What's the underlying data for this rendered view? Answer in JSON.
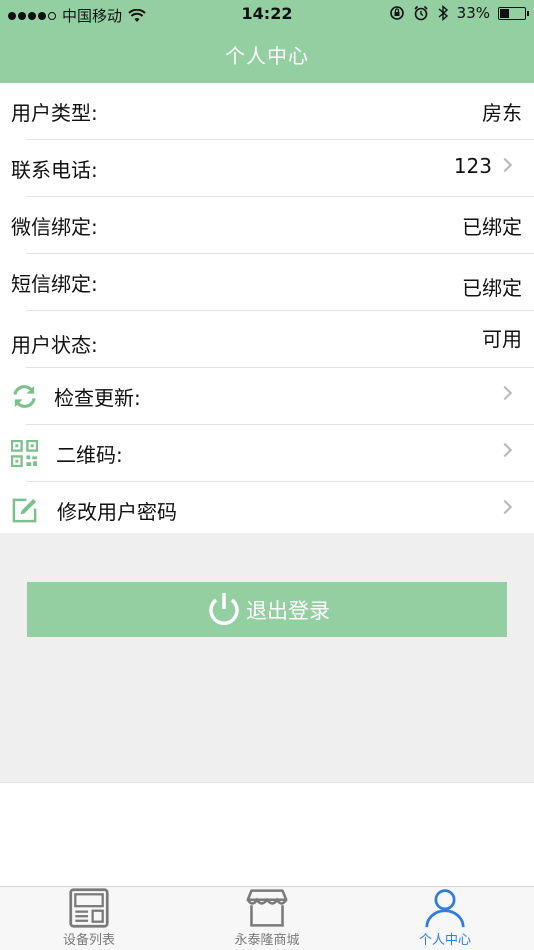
{
  "status_bar": {
    "carrier": "中国移动",
    "time": "14:22",
    "battery": "33%",
    "battery_level": 0.33
  },
  "nav": {
    "title": "个人中心"
  },
  "rows": [
    {
      "label": "用户类型:",
      "value": "房东"
    },
    {
      "label": "联系电话:",
      "value": "123"
    },
    {
      "label": "微信绑定:",
      "value": "已绑定"
    },
    {
      "label": "短信绑定:",
      "value": "已绑定"
    },
    {
      "label": "用户状态:",
      "value": "可用"
    },
    {
      "label": "检查更新:",
      "icon": "refresh-icon"
    },
    {
      "label": "二维码:",
      "icon": "qr-code-icon"
    },
    {
      "label": "修改用户密码",
      "icon": "edit-icon"
    }
  ],
  "logout": {
    "label": "退出登录",
    "icon": "power-icon"
  },
  "tabs": [
    {
      "label": "设备列表",
      "icon": "device-list-icon"
    },
    {
      "label": "永泰隆商城",
      "icon": "store-icon"
    },
    {
      "label": "个人中心",
      "icon": "person-icon",
      "active": true
    }
  ],
  "colors": {
    "accent": "#94cfa1",
    "tab_active": "#2f7de1"
  }
}
